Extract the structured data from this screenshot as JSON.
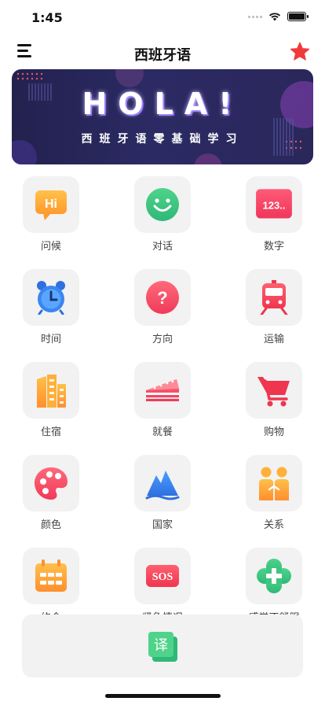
{
  "status": {
    "time": "1:45"
  },
  "header": {
    "title": "西班牙语"
  },
  "banner": {
    "headline": "HOLA!",
    "subtitle": "西班牙语零基础学习"
  },
  "categories": [
    {
      "label": "问候",
      "icon": "hi-bubble-icon"
    },
    {
      "label": "对话",
      "icon": "smiley-icon"
    },
    {
      "label": "数字",
      "icon": "numbers-icon"
    },
    {
      "label": "时间",
      "icon": "alarm-clock-icon"
    },
    {
      "label": "方向",
      "icon": "question-icon"
    },
    {
      "label": "运输",
      "icon": "train-icon"
    },
    {
      "label": "住宿",
      "icon": "buildings-icon"
    },
    {
      "label": "就餐",
      "icon": "cake-icon"
    },
    {
      "label": "购物",
      "icon": "cart-icon"
    },
    {
      "label": "颜色",
      "icon": "palette-icon"
    },
    {
      "label": "国家",
      "icon": "mountain-icon"
    },
    {
      "label": "关系",
      "icon": "people-icon"
    },
    {
      "label": "约会",
      "icon": "calendar-icon"
    },
    {
      "label": "紧急情况",
      "icon": "sos-icon"
    },
    {
      "label": "感觉不舒服",
      "icon": "medical-cross-icon"
    }
  ],
  "translate": {
    "glyph": "译"
  },
  "colors": {
    "accent_red": "#f03a3a",
    "tile_bg": "#f2f2f2",
    "banner_bg": "#2b2a63"
  }
}
